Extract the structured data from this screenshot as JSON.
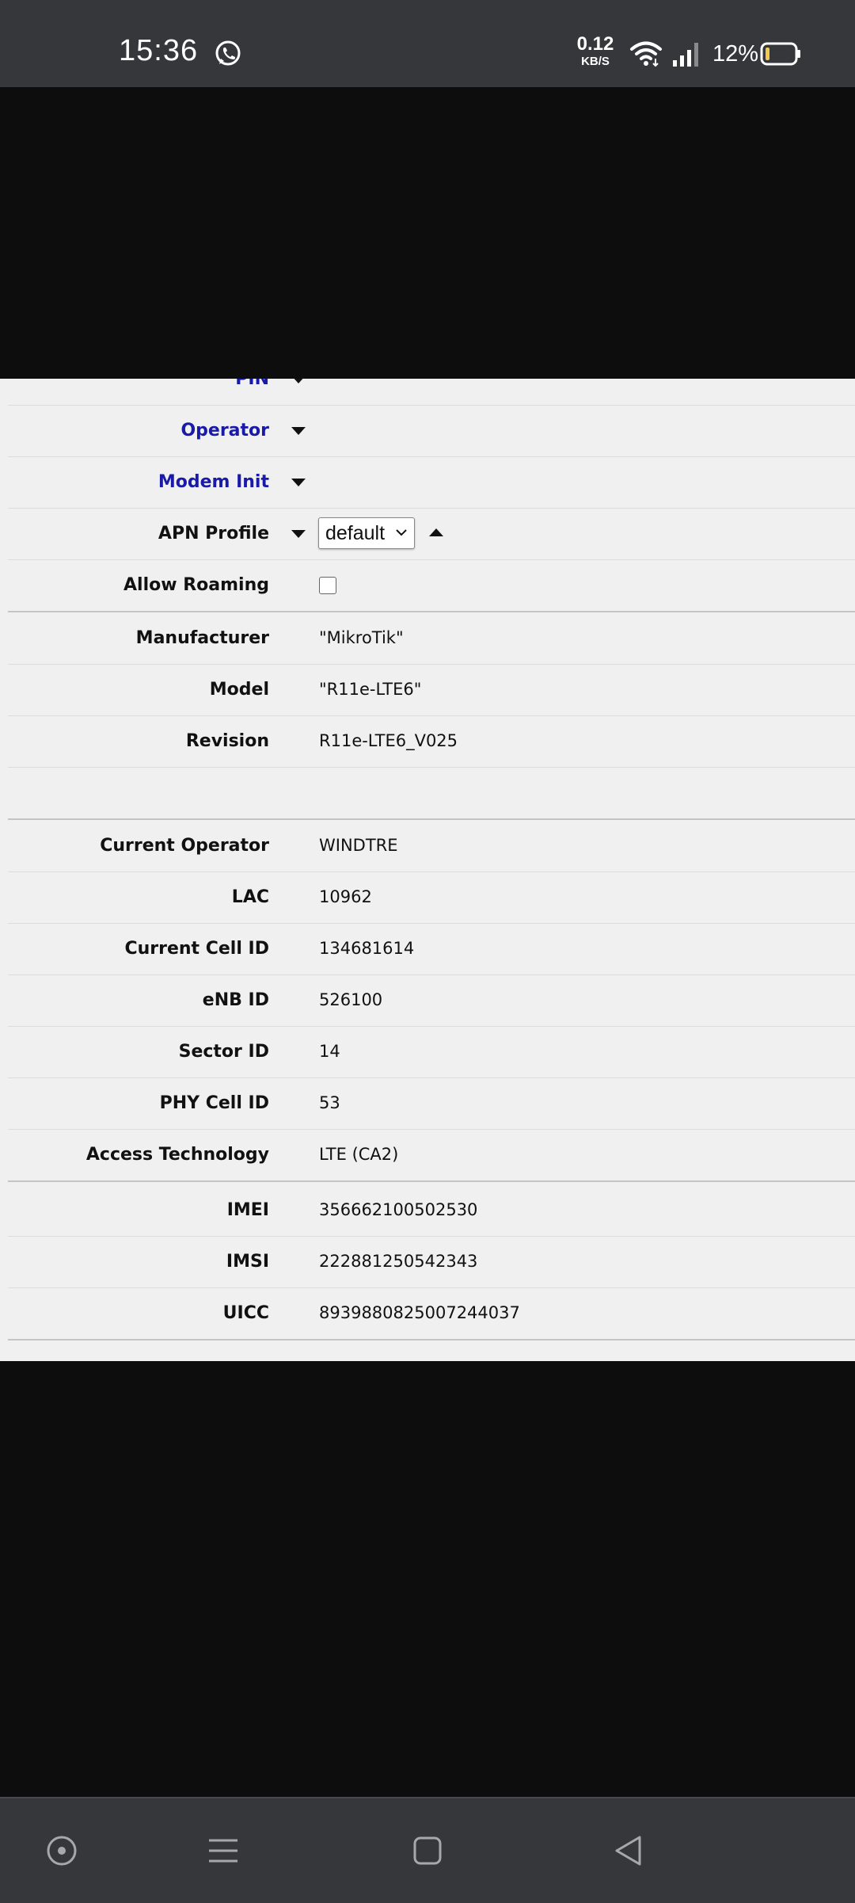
{
  "status_bar": {
    "time": "15:36",
    "net_speed_value": "0.12",
    "net_speed_unit": "KB/S",
    "battery_percent": "12%",
    "icons": [
      "whatsapp-icon",
      "wifi-icon",
      "signal-icon",
      "battery-icon"
    ]
  },
  "settings": {
    "pin_label": "PIN",
    "operator_label": "Operator",
    "modem_init_label": "Modem Init",
    "apn_profile_label": "APN Profile",
    "apn_profile_value": "default",
    "allow_roaming_label": "Allow Roaming"
  },
  "device_info": [
    {
      "label": "Manufacturer",
      "value": "\"MikroTik\""
    },
    {
      "label": "Model",
      "value": "\"R11e-LTE6\""
    },
    {
      "label": "Revision",
      "value": "R11e-LTE6_V025"
    }
  ],
  "network_info": [
    {
      "label": "Current Operator",
      "value": "WINDTRE"
    },
    {
      "label": "LAC",
      "value": "10962"
    },
    {
      "label": "Current Cell ID",
      "value": "134681614"
    },
    {
      "label": "eNB ID",
      "value": "526100"
    },
    {
      "label": "Sector ID",
      "value": "14"
    },
    {
      "label": "PHY Cell ID",
      "value": "53"
    },
    {
      "label": "Access Technology",
      "value": "LTE (CA2)"
    }
  ],
  "sim_info": [
    {
      "label": "IMEI",
      "value": "356662100502530"
    },
    {
      "label": "IMSI",
      "value": "222881250542343"
    },
    {
      "label": "UICC",
      "value": "8939880825007244037"
    }
  ],
  "colors": {
    "link_label": "#1a1aa8",
    "status_bar": "#36373b",
    "panel_bg": "#f0f0f0",
    "battery_low": "#f2c94c"
  },
  "nav_bar": {
    "icons": [
      "assistant-icon",
      "menu-icon",
      "home-icon",
      "back-icon"
    ]
  }
}
